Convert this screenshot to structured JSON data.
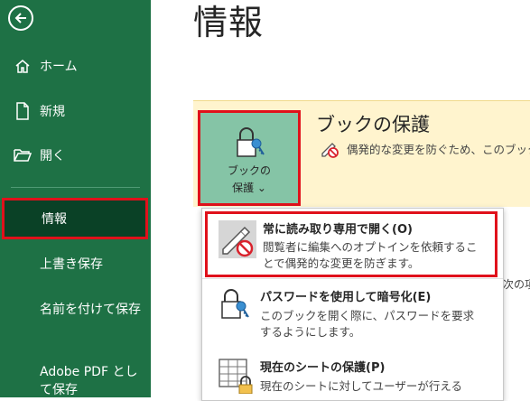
{
  "sidebar": {
    "home": "ホーム",
    "new": "新規",
    "open": "開く",
    "info": "情報",
    "save_overwrite": "上書き保存",
    "save_as": "名前を付けて保存",
    "adobe_pdf": "Adobe PDF として保存"
  },
  "page_title": "情報",
  "protect": {
    "button_line1": "ブックの",
    "button_line2": "保護 ⌄",
    "title": "ブックの保護",
    "description": "偶発的な変更を防ぐため、このブック"
  },
  "menu": {
    "items": [
      {
        "title": "常に読み取り専用で開く(O)",
        "desc": "閲覧者に編集へのオプトインを依頼することで偶発的な変更を防ぎます。"
      },
      {
        "title": "パスワードを使用して暗号化(E)",
        "desc": "このブックを開く際に、パスワードを要求するようにします。"
      },
      {
        "title": "現在のシートの保護(P)",
        "desc": "現在のシートに対してユーザーが行える"
      }
    ]
  },
  "edge_text": "次の項",
  "colors": {
    "sidebar": "#1e7145",
    "selected": "#0a4126",
    "highlight": "#e0111b",
    "panel": "#fff4ce",
    "button": "#85c4a6"
  }
}
